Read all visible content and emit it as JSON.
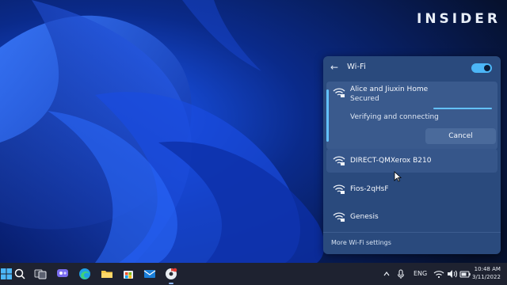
{
  "watermark": {
    "brand": "INSIDER"
  },
  "wifi_panel": {
    "back_glyph": "←",
    "title": "Wi-Fi",
    "toggle_on": true,
    "connecting_network": {
      "name": "Alice and Jiuxin Home",
      "security": "Secured",
      "status": "Verifying and connecting",
      "cancel_label": "Cancel"
    },
    "networks": [
      {
        "name": "DIRECT-QMXerox B210",
        "secured": true
      },
      {
        "name": "Fios-2qHsF",
        "secured": true
      },
      {
        "name": "Genesis",
        "secured": true
      }
    ],
    "more_settings_label": "More Wi-Fi settings"
  },
  "taskbar": {
    "icons": [
      "windows-start-icon",
      "search-icon",
      "task-view-icon",
      "chat-icon",
      "edge-icon",
      "file-explorer-icon",
      "store-icon",
      "mail-icon",
      "chrome-icon"
    ],
    "tray": {
      "language": "ENG",
      "time": "10:48 AM",
      "date": "3/11/2022"
    }
  },
  "colors": {
    "accent": "#4cb6f7",
    "panel_bg": "#2a4a7d",
    "taskbar_bg": "#1e2230"
  }
}
